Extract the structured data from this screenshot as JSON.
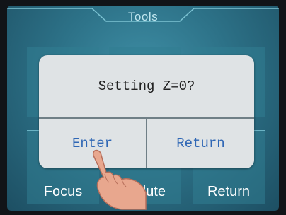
{
  "header": {
    "title": "Tools"
  },
  "tiles": [
    {
      "label": ""
    },
    {
      "label": ""
    },
    {
      "label": ""
    },
    {
      "label": "Focus"
    },
    {
      "label": "lute"
    },
    {
      "label": "Return"
    }
  ],
  "dialog": {
    "message": "Setting Z=0?",
    "enter_label": "Enter",
    "return_label": "Return"
  },
  "colors": {
    "screen_bg": "#2d7288",
    "dialog_bg": "#dfe3e5",
    "dialog_button_text": "#2f67b5"
  }
}
